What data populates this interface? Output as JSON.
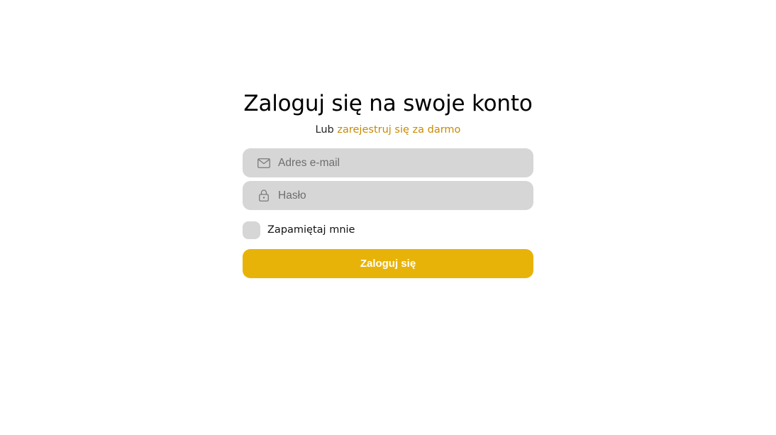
{
  "header": {
    "title": "Zaloguj się na swoje konto",
    "subtitle_prefix": "Lub",
    "register_link": "zarejestruj się za darmo"
  },
  "form": {
    "email": {
      "placeholder": "Adres e-mail",
      "value": "",
      "icon": "mail-icon"
    },
    "password": {
      "placeholder": "Hasło",
      "value": "",
      "icon": "lock-icon"
    },
    "remember_label": "Zapamiętaj mnie",
    "remember_checked": false,
    "submit_label": "Zaloguj się"
  },
  "colors": {
    "accent": "#e8b308",
    "link": "#c98a00",
    "field_bg": "#d6d6d6"
  }
}
